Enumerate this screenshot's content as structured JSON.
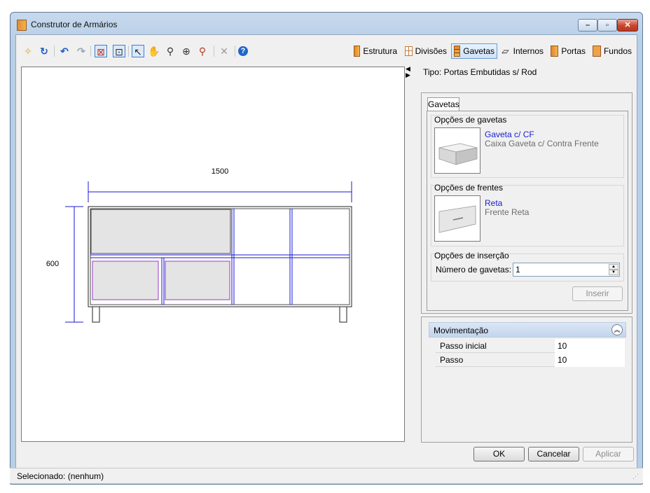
{
  "window": {
    "title": "Construtor de Armários"
  },
  "toolbar": {
    "icons": [
      "new-icon",
      "refresh-icon",
      "undo-icon",
      "redo-icon",
      "view-mode-icon",
      "view-mode-2-icon",
      "select-pointer-icon",
      "pan-hand-icon",
      "zoom-in-icon",
      "zoom-extents-icon",
      "zoom-window-icon",
      "delete-icon",
      "help-icon"
    ],
    "tabs": [
      {
        "label": "Estrutura",
        "icon": "cabinet-structure-icon"
      },
      {
        "label": "Divisões",
        "icon": "grid-divisions-icon"
      },
      {
        "label": "Gavetas",
        "icon": "drawer-icon",
        "selected": true
      },
      {
        "label": "Internos",
        "icon": "internos-icon"
      },
      {
        "label": "Portas",
        "icon": "door-icon"
      },
      {
        "label": "Fundos",
        "icon": "back-panel-icon"
      }
    ]
  },
  "drawing": {
    "width_label": "1500",
    "height_label": "600"
  },
  "panel": {
    "tipo": "Tipo: Portas Embutidas s/ Rod",
    "tab_label": "Gavetas",
    "drawer_options": {
      "heading": "Opções de gavetas",
      "item_name": "Gaveta c/ CF",
      "item_desc": "Caixa Gaveta c/ Contra Frente"
    },
    "front_options": {
      "heading": "Opções de frentes",
      "item_name": "Reta",
      "item_desc": "Frente Reta"
    },
    "insert_options": {
      "heading": "Opções de inserção",
      "count_label": "Número de gavetas:",
      "count_value": "1",
      "insert_button": "Inserir"
    }
  },
  "movement": {
    "title": "Movimentação",
    "rows": [
      {
        "label": "Passo inicial",
        "value": "10"
      },
      {
        "label": "Passo",
        "value": "10"
      }
    ]
  },
  "buttons": {
    "ok": "OK",
    "cancel": "Cancelar",
    "apply": "Aplicar"
  },
  "status": {
    "text": "Selecionado: (nenhum)"
  },
  "colors": {
    "dimension_line": "#1a1ad0",
    "drawer_outline": "#9a37c9",
    "panel_fill": "#e4e4e4",
    "selected_tab": "#cfe2f7"
  }
}
